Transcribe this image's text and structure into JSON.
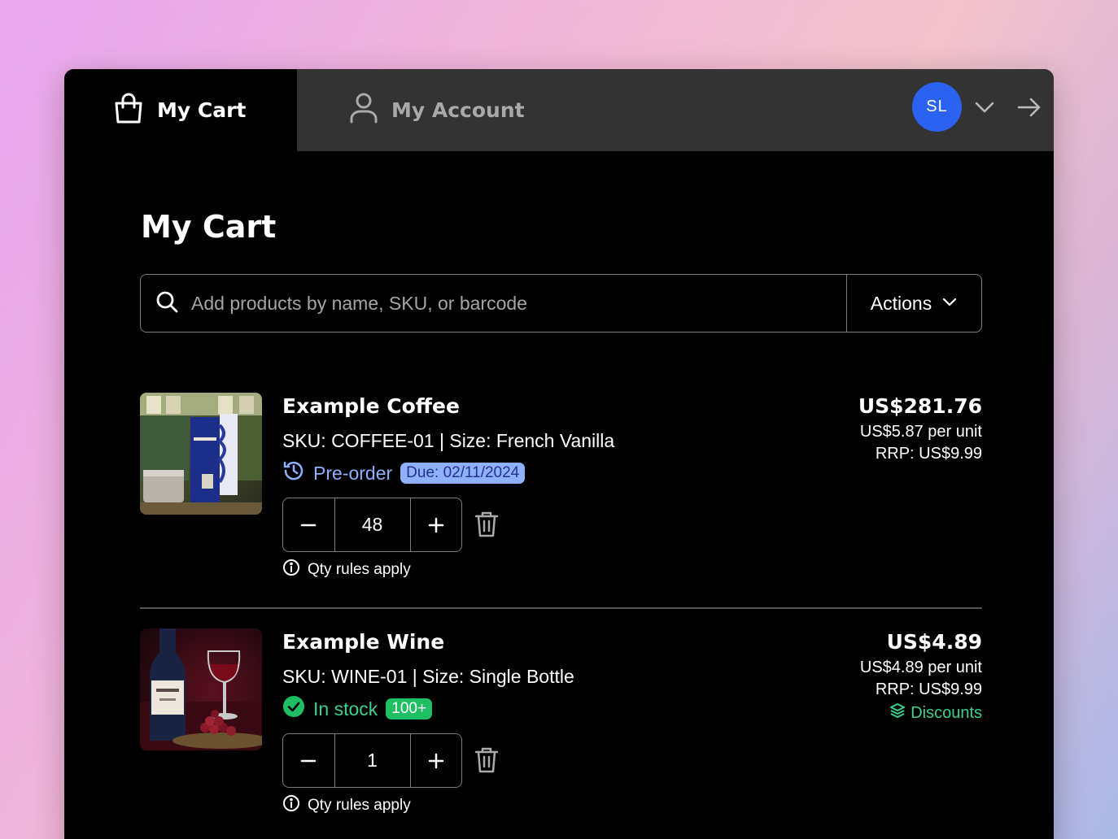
{
  "nav": {
    "cart_tab": "My Cart",
    "account_tab": "My Account",
    "avatar_initials": "SL"
  },
  "page": {
    "title": "My Cart"
  },
  "search": {
    "placeholder": "Add products by name, SKU, or barcode",
    "actions_label": "Actions"
  },
  "items": [
    {
      "name": "Example Coffee",
      "sku_line": "SKU: COFFEE-01 | Size: French Vanilla",
      "status": "Pre-order",
      "badge": "Due: 02/11/2024",
      "qty": "48",
      "qty_rules": "Qty rules apply",
      "total": "US$281.76",
      "per_unit": "US$5.87 per unit",
      "rrp": "RRP: US$9.99"
    },
    {
      "name": "Example Wine",
      "sku_line": "SKU: WINE-01 | Size: Single Bottle",
      "status": "In stock",
      "badge": "100+",
      "qty": "1",
      "qty_rules": "Qty rules apply",
      "total": "US$4.89",
      "per_unit": "US$4.89 per unit",
      "rrp": "RRP: US$9.99",
      "discounts": "Discounts"
    }
  ],
  "colors": {
    "accent_blue": "#2b63f0",
    "preorder": "#8fb0ff",
    "in_stock": "#3ecf8e"
  },
  "icons": [
    "shopping-bag-icon",
    "user-icon",
    "chevron-down-icon",
    "arrow-right-icon",
    "search-icon",
    "history-icon",
    "check-circle-icon",
    "minus-icon",
    "plus-icon",
    "trash-icon",
    "info-icon",
    "layers-icon"
  ]
}
